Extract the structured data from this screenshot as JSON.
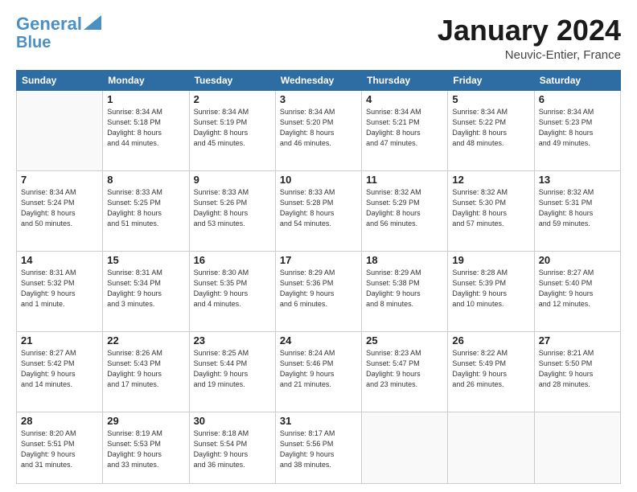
{
  "header": {
    "logo_line1": "General",
    "logo_line2": "Blue",
    "month": "January 2024",
    "location": "Neuvic-Entier, France"
  },
  "days_of_week": [
    "Sunday",
    "Monday",
    "Tuesday",
    "Wednesday",
    "Thursday",
    "Friday",
    "Saturday"
  ],
  "weeks": [
    [
      {
        "day": "",
        "info": ""
      },
      {
        "day": "1",
        "info": "Sunrise: 8:34 AM\nSunset: 5:18 PM\nDaylight: 8 hours\nand 44 minutes."
      },
      {
        "day": "2",
        "info": "Sunrise: 8:34 AM\nSunset: 5:19 PM\nDaylight: 8 hours\nand 45 minutes."
      },
      {
        "day": "3",
        "info": "Sunrise: 8:34 AM\nSunset: 5:20 PM\nDaylight: 8 hours\nand 46 minutes."
      },
      {
        "day": "4",
        "info": "Sunrise: 8:34 AM\nSunset: 5:21 PM\nDaylight: 8 hours\nand 47 minutes."
      },
      {
        "day": "5",
        "info": "Sunrise: 8:34 AM\nSunset: 5:22 PM\nDaylight: 8 hours\nand 48 minutes."
      },
      {
        "day": "6",
        "info": "Sunrise: 8:34 AM\nSunset: 5:23 PM\nDaylight: 8 hours\nand 49 minutes."
      }
    ],
    [
      {
        "day": "7",
        "info": "Sunrise: 8:34 AM\nSunset: 5:24 PM\nDaylight: 8 hours\nand 50 minutes."
      },
      {
        "day": "8",
        "info": "Sunrise: 8:33 AM\nSunset: 5:25 PM\nDaylight: 8 hours\nand 51 minutes."
      },
      {
        "day": "9",
        "info": "Sunrise: 8:33 AM\nSunset: 5:26 PM\nDaylight: 8 hours\nand 53 minutes."
      },
      {
        "day": "10",
        "info": "Sunrise: 8:33 AM\nSunset: 5:28 PM\nDaylight: 8 hours\nand 54 minutes."
      },
      {
        "day": "11",
        "info": "Sunrise: 8:32 AM\nSunset: 5:29 PM\nDaylight: 8 hours\nand 56 minutes."
      },
      {
        "day": "12",
        "info": "Sunrise: 8:32 AM\nSunset: 5:30 PM\nDaylight: 8 hours\nand 57 minutes."
      },
      {
        "day": "13",
        "info": "Sunrise: 8:32 AM\nSunset: 5:31 PM\nDaylight: 8 hours\nand 59 minutes."
      }
    ],
    [
      {
        "day": "14",
        "info": "Sunrise: 8:31 AM\nSunset: 5:32 PM\nDaylight: 9 hours\nand 1 minute."
      },
      {
        "day": "15",
        "info": "Sunrise: 8:31 AM\nSunset: 5:34 PM\nDaylight: 9 hours\nand 3 minutes."
      },
      {
        "day": "16",
        "info": "Sunrise: 8:30 AM\nSunset: 5:35 PM\nDaylight: 9 hours\nand 4 minutes."
      },
      {
        "day": "17",
        "info": "Sunrise: 8:29 AM\nSunset: 5:36 PM\nDaylight: 9 hours\nand 6 minutes."
      },
      {
        "day": "18",
        "info": "Sunrise: 8:29 AM\nSunset: 5:38 PM\nDaylight: 9 hours\nand 8 minutes."
      },
      {
        "day": "19",
        "info": "Sunrise: 8:28 AM\nSunset: 5:39 PM\nDaylight: 9 hours\nand 10 minutes."
      },
      {
        "day": "20",
        "info": "Sunrise: 8:27 AM\nSunset: 5:40 PM\nDaylight: 9 hours\nand 12 minutes."
      }
    ],
    [
      {
        "day": "21",
        "info": "Sunrise: 8:27 AM\nSunset: 5:42 PM\nDaylight: 9 hours\nand 14 minutes."
      },
      {
        "day": "22",
        "info": "Sunrise: 8:26 AM\nSunset: 5:43 PM\nDaylight: 9 hours\nand 17 minutes."
      },
      {
        "day": "23",
        "info": "Sunrise: 8:25 AM\nSunset: 5:44 PM\nDaylight: 9 hours\nand 19 minutes."
      },
      {
        "day": "24",
        "info": "Sunrise: 8:24 AM\nSunset: 5:46 PM\nDaylight: 9 hours\nand 21 minutes."
      },
      {
        "day": "25",
        "info": "Sunrise: 8:23 AM\nSunset: 5:47 PM\nDaylight: 9 hours\nand 23 minutes."
      },
      {
        "day": "26",
        "info": "Sunrise: 8:22 AM\nSunset: 5:49 PM\nDaylight: 9 hours\nand 26 minutes."
      },
      {
        "day": "27",
        "info": "Sunrise: 8:21 AM\nSunset: 5:50 PM\nDaylight: 9 hours\nand 28 minutes."
      }
    ],
    [
      {
        "day": "28",
        "info": "Sunrise: 8:20 AM\nSunset: 5:51 PM\nDaylight: 9 hours\nand 31 minutes."
      },
      {
        "day": "29",
        "info": "Sunrise: 8:19 AM\nSunset: 5:53 PM\nDaylight: 9 hours\nand 33 minutes."
      },
      {
        "day": "30",
        "info": "Sunrise: 8:18 AM\nSunset: 5:54 PM\nDaylight: 9 hours\nand 36 minutes."
      },
      {
        "day": "31",
        "info": "Sunrise: 8:17 AM\nSunset: 5:56 PM\nDaylight: 9 hours\nand 38 minutes."
      },
      {
        "day": "",
        "info": ""
      },
      {
        "day": "",
        "info": ""
      },
      {
        "day": "",
        "info": ""
      }
    ]
  ]
}
